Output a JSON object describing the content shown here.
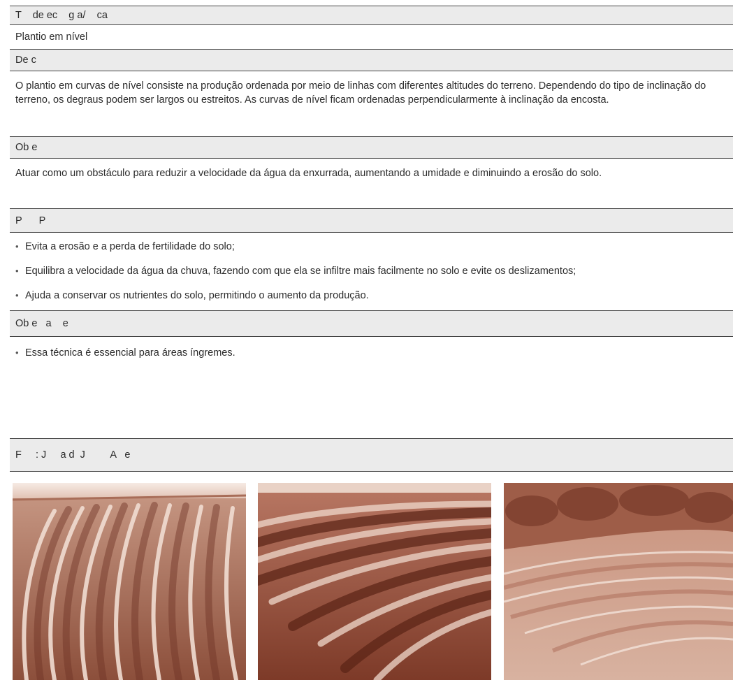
{
  "sections": [
    {
      "heading": "T    de ec    g a/    ca",
      "content": "Plantio em nível"
    },
    {
      "heading": "De c",
      "content": "O plantio em curvas de nível consiste na produção ordenada por meio de linhas com diferentes altitudes do terreno. Dependendo do tipo de inclinação do terreno, os degraus podem ser largos ou estreitos. As curvas de nível ficam ordenadas perpendicularmente à inclinação da encosta."
    },
    {
      "heading": "Ob e",
      "content": "Atuar como um obstáculo para reduzir a velocidade da água da enxurrada, aumentando a umidade e diminuindo a erosão do solo."
    },
    {
      "heading": "P      P",
      "bullets": [
        "Evita a erosão e a perda de fertilidade do solo;",
        "Equilibra a velocidade da água da chuva, fazendo com que ela se infiltre mais facilmente no solo e evite os deslizamentos;",
        "Ajuda a conservar os nutrientes do solo, permitindo o aumento da produção."
      ]
    },
    {
      "heading": "Ob e   a    e",
      "bullets": [
        "Essa técnica é essencial para áreas íngremes."
      ]
    },
    {
      "heading": "F     : J     a d  J         A   e"
    }
  ],
  "bullet_symbol": "•",
  "photos": [
    {
      "name": "field-photo-curved-rows"
    },
    {
      "name": "field-photo-dark-furrows"
    },
    {
      "name": "field-photo-hillside-terraces"
    }
  ],
  "colors": {
    "header_bg": "#ebebeb",
    "rule": "#444444",
    "photo_tint": "#9a5a45"
  }
}
